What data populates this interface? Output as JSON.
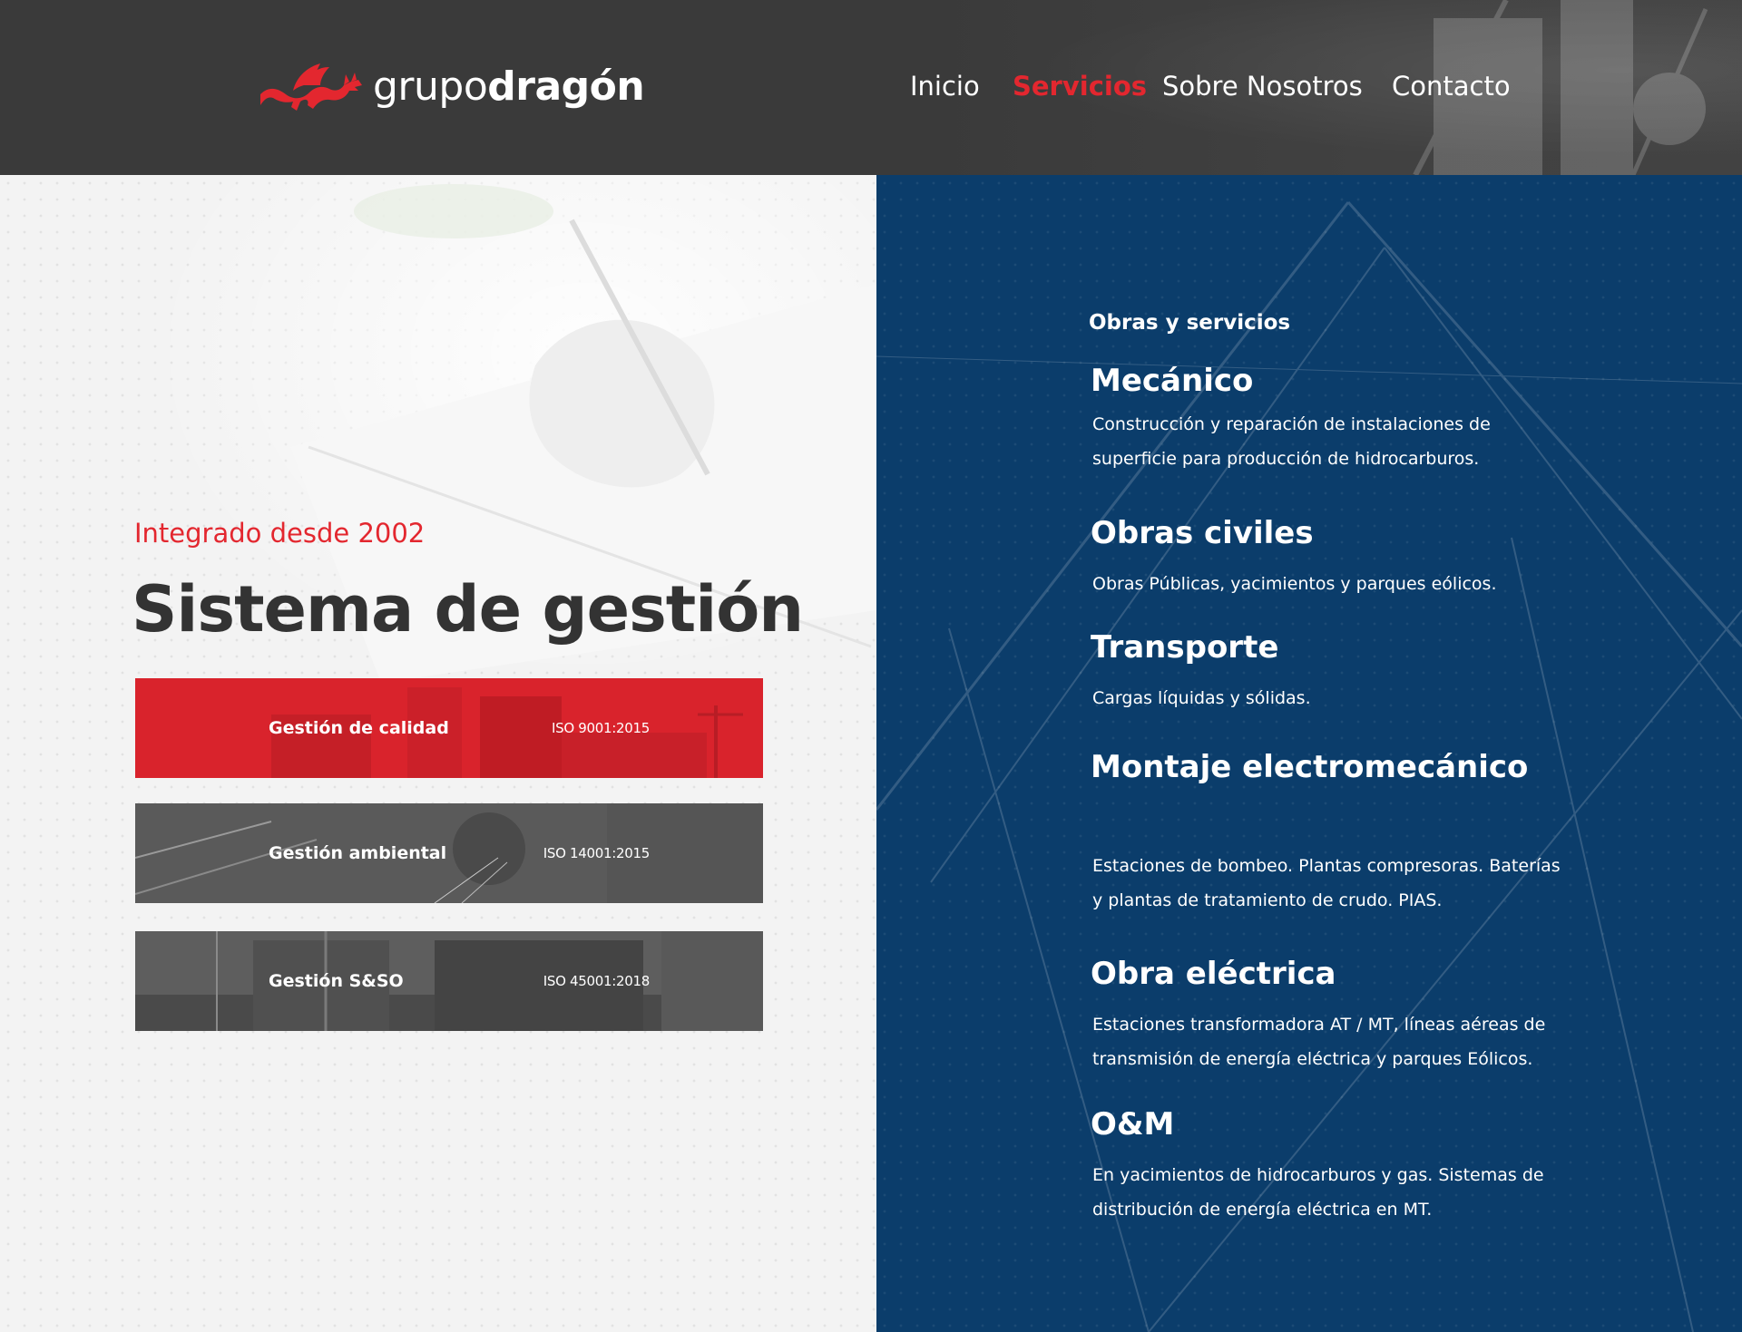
{
  "header": {
    "logo": {
      "light": "grupo",
      "bold": "dragón",
      "icon": "dragon-icon"
    },
    "nav": [
      {
        "label": "Inicio",
        "active": false
      },
      {
        "label": "Servicios",
        "active": true
      },
      {
        "label": "Sobre Nosotros",
        "active": false
      },
      {
        "label": "Contacto",
        "active": false
      }
    ]
  },
  "management": {
    "subtitle": "Integrado desde 2002",
    "title": "Sistema de gestión",
    "certifications": [
      {
        "name": "Gestión de calidad",
        "iso": "ISO 9001:2015"
      },
      {
        "name": "Gestión ambiental",
        "iso": "ISO 14001:2015"
      },
      {
        "name": "Gestión S&SO",
        "iso": "ISO 45001:2018"
      }
    ]
  },
  "services": {
    "heading": "Obras y servicios",
    "items": [
      {
        "title": "Mecánico",
        "description": "Construcción y reparación de instalaciones de superficie para producción de hidrocarburos."
      },
      {
        "title": "Obras civiles",
        "description": "Obras Públicas, yacimientos y parques eólicos."
      },
      {
        "title": "Transporte",
        "description": "Cargas líquidas y sólidas."
      },
      {
        "title": "Montaje electromecánico",
        "description": "Estaciones de bombeo. Plantas compresoras. Baterías y plantas de tratamiento de crudo. PIAS."
      },
      {
        "title": "Obra eléctrica",
        "description": "Estaciones transformadora AT / MT, líneas aéreas de transmisión de energía eléctrica y parques Eólicos."
      },
      {
        "title": "O&M",
        "description": "En yacimientos de hidrocarburos y gas. Sistemas de distribución de energía eléctrica en MT."
      }
    ]
  },
  "colors": {
    "header_bg": "#3a3a3a",
    "accent_red": "#e3272f",
    "navy": "#0b3d6b",
    "left_bg": "#f3f3f3",
    "title_text": "#333333"
  }
}
